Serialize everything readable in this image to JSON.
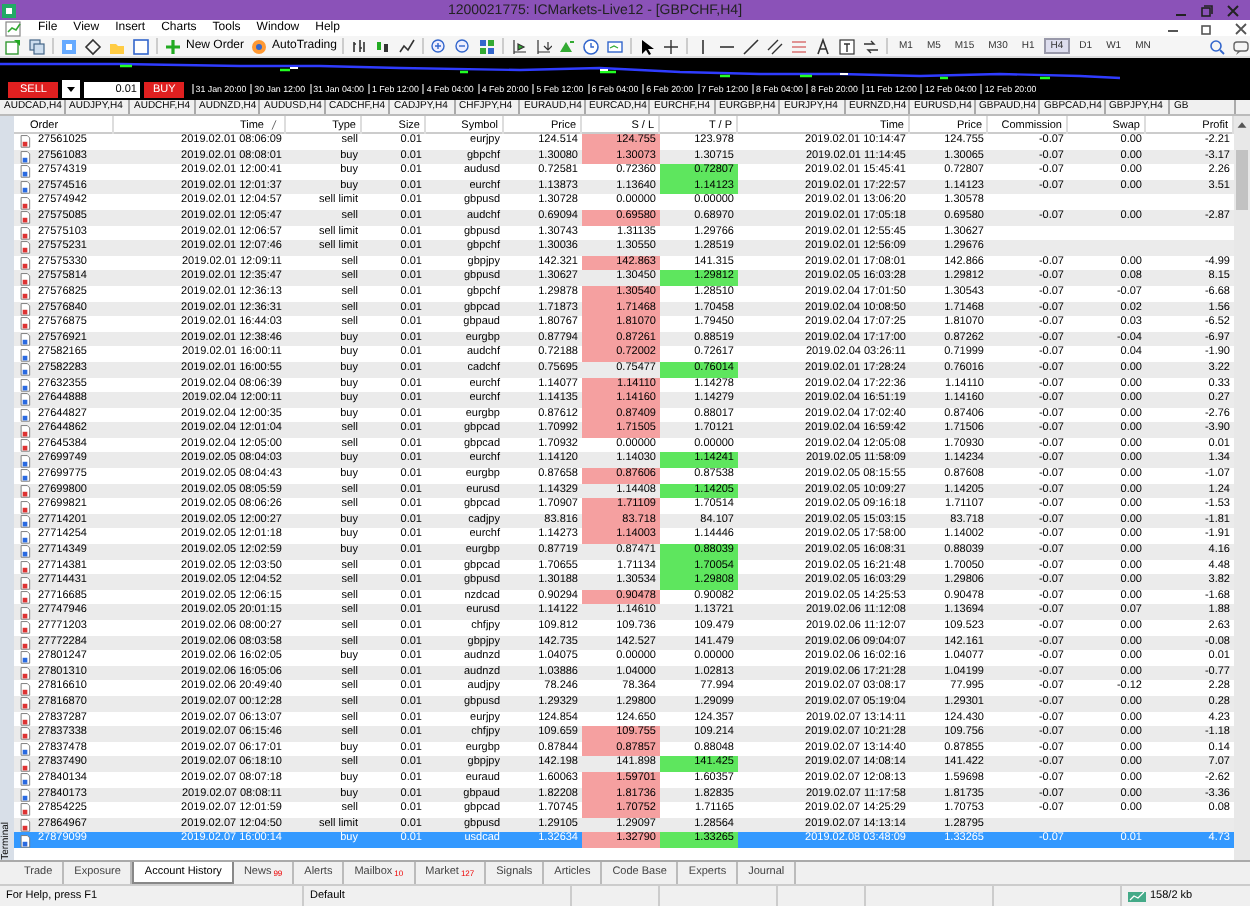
{
  "window": {
    "title": "1200021775: ICMarkets-Live12 - [GBPCHF,H4]"
  },
  "menu": [
    "File",
    "View",
    "Insert",
    "Charts",
    "Tools",
    "Window",
    "Help"
  ],
  "toolbar": {
    "buttons": [
      "New Order",
      "AutoTrading"
    ],
    "timeframes": [
      {
        "label": "M1",
        "selected": false
      },
      {
        "label": "M5",
        "selected": false
      },
      {
        "label": "M15",
        "selected": false
      },
      {
        "label": "M30",
        "selected": false
      },
      {
        "label": "H1",
        "selected": false
      },
      {
        "label": "H4",
        "selected": true
      },
      {
        "label": "D1",
        "selected": false
      },
      {
        "label": "W1",
        "selected": false
      },
      {
        "label": "MN",
        "selected": false
      }
    ]
  },
  "one_click": {
    "sell": "SELL",
    "lot": "0.01",
    "buy": "BUY"
  },
  "chart_axis": [
    "31 Jan 20:00",
    "30 Jan 12:00",
    "31 Jan 04:00",
    "1 Feb 12:00",
    "4 Feb 04:00",
    "4 Feb 20:00",
    "5 Feb 12:00",
    "6 Feb 04:00",
    "6 Feb 20:00",
    "7 Feb 12:00",
    "8 Feb 04:00",
    "8 Feb 20:00",
    "11 Feb 12:00",
    "12 Feb 04:00",
    "12 Feb 20:00"
  ],
  "chart_tabs": [
    "AUDCAD,H4",
    "AUDJPY,H4",
    "AUDCHF,H4",
    "AUDNZD,H4",
    "AUDUSD,H4",
    "CADCHF,H4",
    "CADJPY,H4",
    "CHFJPY,H4",
    "EURAUD,H4",
    "EURCAD,H4",
    "EURCHF,H4",
    "EURGBP,H4",
    "EURJPY,H4",
    "EURNZD,H4",
    "EURUSD,H4",
    "GBPAUD,H4",
    "GBPCAD,H4",
    "GBPJPY,H4",
    "GB"
  ],
  "table": {
    "columns": [
      "Order",
      "Time",
      "Type",
      "Size",
      "Symbol",
      "Price",
      "S / L",
      "T / P",
      "Time",
      "Price",
      "Commission",
      "Swap",
      "Profit"
    ],
    "rows": [
      {
        "order": "27561025",
        "open_time": "2019.02.01 08:06:09",
        "type": "sell",
        "size": "0.01",
        "symbol": "eurjpy",
        "price": "124.514",
        "sl": "124.755",
        "tp": "123.978",
        "close_time": "2019.02.01 10:14:47",
        "close_price": "124.755",
        "commission": "-0.07",
        "swap": "0.00",
        "profit": "-2.21",
        "sl_marked": true,
        "tp_marked": false,
        "selected": false
      },
      {
        "order": "27561083",
        "open_time": "2019.02.01 08:08:01",
        "type": "buy",
        "size": "0.01",
        "symbol": "gbpchf",
        "price": "1.30080",
        "sl": "1.30073",
        "tp": "1.30715",
        "close_time": "2019.02.01 11:14:45",
        "close_price": "1.30065",
        "commission": "-0.07",
        "swap": "0.00",
        "profit": "-3.17",
        "sl_marked": true,
        "tp_marked": false,
        "selected": false
      },
      {
        "order": "27574319",
        "open_time": "2019.02.01 12:00:41",
        "type": "buy",
        "size": "0.01",
        "symbol": "audusd",
        "price": "0.72581",
        "sl": "0.72360",
        "tp": "0.72807",
        "close_time": "2019.02.01 15:45:41",
        "close_price": "0.72807",
        "commission": "-0.07",
        "swap": "0.00",
        "profit": "2.26",
        "sl_marked": false,
        "tp_marked": true,
        "selected": false
      },
      {
        "order": "27574516",
        "open_time": "2019.02.01 12:01:37",
        "type": "buy",
        "size": "0.01",
        "symbol": "eurchf",
        "price": "1.13873",
        "sl": "1.13640",
        "tp": "1.14123",
        "close_time": "2019.02.01 17:22:57",
        "close_price": "1.14123",
        "commission": "-0.07",
        "swap": "0.00",
        "profit": "3.51",
        "sl_marked": false,
        "tp_marked": true,
        "selected": false
      },
      {
        "order": "27574942",
        "open_time": "2019.02.01 12:04:57",
        "type": "sell limit",
        "size": "0.01",
        "symbol": "gbpusd",
        "price": "1.30728",
        "sl": "0.00000",
        "tp": "0.00000",
        "close_time": "2019.02.01 13:06:20",
        "close_price": "1.30578",
        "sl_marked": false,
        "tp_marked": false,
        "selected": false
      },
      {
        "order": "27575085",
        "open_time": "2019.02.01 12:05:47",
        "type": "sell",
        "size": "0.01",
        "symbol": "audchf",
        "price": "0.69094",
        "sl": "0.69580",
        "tp": "0.68970",
        "close_time": "2019.02.01 17:05:18",
        "close_price": "0.69580",
        "commission": "-0.07",
        "swap": "0.00",
        "profit": "-2.87",
        "sl_marked": true,
        "tp_marked": false,
        "selected": false
      },
      {
        "order": "27575103",
        "open_time": "2019.02.01 12:06:57",
        "type": "sell limit",
        "size": "0.01",
        "symbol": "gbpusd",
        "price": "1.30743",
        "sl": "1.31135",
        "tp": "1.29766",
        "close_time": "2019.02.01 12:55:45",
        "close_price": "1.30627",
        "sl_marked": false,
        "tp_marked": false,
        "selected": false
      },
      {
        "order": "27575231",
        "open_time": "2019.02.01 12:07:46",
        "type": "sell limit",
        "size": "0.01",
        "symbol": "gbpchf",
        "price": "1.30036",
        "sl": "1.30550",
        "tp": "1.28519",
        "close_time": "2019.02.01 12:56:09",
        "close_price": "1.29676",
        "sl_marked": false,
        "tp_marked": false,
        "selected": false
      },
      {
        "order": "27575330",
        "open_time": "2019.02.01 12:09:11",
        "type": "sell",
        "size": "0.01",
        "symbol": "gbpjpy",
        "price": "142.321",
        "sl": "142.863",
        "tp": "141.315",
        "close_time": "2019.02.01 17:08:01",
        "close_price": "142.866",
        "commission": "-0.07",
        "swap": "0.00",
        "profit": "-4.99",
        "sl_marked": true,
        "tp_marked": false,
        "selected": false
      },
      {
        "order": "27575814",
        "open_time": "2019.02.01 12:35:47",
        "type": "sell",
        "size": "0.01",
        "symbol": "gbpusd",
        "price": "1.30627",
        "sl": "1.30450",
        "tp": "1.29812",
        "close_time": "2019.02.05 16:03:28",
        "close_price": "1.29812",
        "commission": "-0.07",
        "swap": "0.08",
        "profit": "8.15",
        "sl_marked": false,
        "tp_marked": true,
        "selected": false
      },
      {
        "order": "27576825",
        "open_time": "2019.02.01 12:36:13",
        "type": "sell",
        "size": "0.01",
        "symbol": "gbpchf",
        "price": "1.29878",
        "sl": "1.30540",
        "tp": "1.28510",
        "close_time": "2019.02.04 17:01:50",
        "close_price": "1.30543",
        "commission": "-0.07",
        "swap": "-0.07",
        "profit": "-6.68",
        "sl_marked": true,
        "tp_marked": false,
        "selected": false
      },
      {
        "order": "27576840",
        "open_time": "2019.02.01 12:36:31",
        "type": "sell",
        "size": "0.01",
        "symbol": "gbpcad",
        "price": "1.71873",
        "sl": "1.71468",
        "tp": "1.70458",
        "close_time": "2019.02.04 10:08:50",
        "close_price": "1.71468",
        "commission": "-0.07",
        "swap": "0.02",
        "profit": "1.56",
        "sl_marked": true,
        "tp_marked": false,
        "selected": false
      },
      {
        "order": "27576875",
        "open_time": "2019.02.01 16:44:03",
        "type": "sell",
        "size": "0.01",
        "symbol": "gbpaud",
        "price": "1.80767",
        "sl": "1.81070",
        "tp": "1.79450",
        "close_time": "2019.02.04 17:07:25",
        "close_price": "1.81070",
        "commission": "-0.07",
        "swap": "0.03",
        "profit": "-6.52",
        "sl_marked": true,
        "tp_marked": false,
        "selected": false
      },
      {
        "order": "27576921",
        "open_time": "2019.02.01 12:38:46",
        "type": "buy",
        "size": "0.01",
        "symbol": "eurgbp",
        "price": "0.87794",
        "sl": "0.87261",
        "tp": "0.88519",
        "close_time": "2019.02.04 17:17:00",
        "close_price": "0.87262",
        "commission": "-0.07",
        "swap": "-0.04",
        "profit": "-6.97",
        "sl_marked": true,
        "tp_marked": false,
        "selected": false
      },
      {
        "order": "27582165",
        "open_time": "2019.02.01 16:00:11",
        "type": "buy",
        "size": "0.01",
        "symbol": "audchf",
        "price": "0.72188",
        "sl": "0.72002",
        "tp": "0.72617",
        "close_time": "2019.02.04 03:26:11",
        "close_price": "0.71999",
        "commission": "-0.07",
        "swap": "0.04",
        "profit": "-1.90",
        "sl_marked": true,
        "tp_marked": false,
        "selected": false
      },
      {
        "order": "27582283",
        "open_time": "2019.02.01 16:00:55",
        "type": "buy",
        "size": "0.01",
        "symbol": "cadchf",
        "price": "0.75695",
        "sl": "0.75477",
        "tp": "0.76014",
        "close_time": "2019.02.01 17:28:24",
        "close_price": "0.76016",
        "commission": "-0.07",
        "swap": "0.00",
        "profit": "3.22",
        "sl_marked": false,
        "tp_marked": true,
        "selected": false
      },
      {
        "order": "27632355",
        "open_time": "2019.02.04 08:06:39",
        "type": "buy",
        "size": "0.01",
        "symbol": "eurchf",
        "price": "1.14077",
        "sl": "1.14110",
        "tp": "1.14278",
        "close_time": "2019.02.04 17:22:36",
        "close_price": "1.14110",
        "commission": "-0.07",
        "swap": "0.00",
        "profit": "0.33",
        "sl_marked": true,
        "tp_marked": false,
        "selected": false
      },
      {
        "order": "27644888",
        "open_time": "2019.02.04 12:00:11",
        "type": "buy",
        "size": "0.01",
        "symbol": "eurchf",
        "price": "1.14135",
        "sl": "1.14160",
        "tp": "1.14279",
        "close_time": "2019.02.04 16:51:19",
        "close_price": "1.14160",
        "commission": "-0.07",
        "swap": "0.00",
        "profit": "0.27",
        "sl_marked": true,
        "tp_marked": false,
        "selected": false
      },
      {
        "order": "27644827",
        "open_time": "2019.02.04 12:00:35",
        "type": "buy",
        "size": "0.01",
        "symbol": "eurgbp",
        "price": "0.87612",
        "sl": "0.87409",
        "tp": "0.88017",
        "close_time": "2019.02.04 17:02:40",
        "close_price": "0.87406",
        "commission": "-0.07",
        "swap": "0.00",
        "profit": "-2.76",
        "sl_marked": true,
        "tp_marked": false,
        "selected": false
      },
      {
        "order": "27644862",
        "open_time": "2019.02.04 12:01:04",
        "type": "sell",
        "size": "0.01",
        "symbol": "gbpcad",
        "price": "1.70992",
        "sl": "1.71505",
        "tp": "1.70121",
        "close_time": "2019.02.04 16:59:42",
        "close_price": "1.71506",
        "commission": "-0.07",
        "swap": "0.00",
        "profit": "-3.90",
        "sl_marked": true,
        "tp_marked": false,
        "selected": false
      },
      {
        "order": "27645384",
        "open_time": "2019.02.04 12:05:00",
        "type": "sell",
        "size": "0.01",
        "symbol": "gbpcad",
        "price": "1.70932",
        "sl": "0.00000",
        "tp": "0.00000",
        "close_time": "2019.02.04 12:05:08",
        "close_price": "1.70930",
        "commission": "-0.07",
        "swap": "0.00",
        "profit": "0.01",
        "sl_marked": false,
        "tp_marked": false,
        "selected": false
      },
      {
        "order": "27699749",
        "open_time": "2019.02.05 08:04:03",
        "type": "buy",
        "size": "0.01",
        "symbol": "eurchf",
        "price": "1.14120",
        "sl": "1.14030",
        "tp": "1.14241",
        "close_time": "2019.02.05 11:58:09",
        "close_price": "1.14234",
        "commission": "-0.07",
        "swap": "0.00",
        "profit": "1.34",
        "sl_marked": false,
        "tp_marked": true,
        "selected": false
      },
      {
        "order": "27699775",
        "open_time": "2019.02.05 08:04:43",
        "type": "buy",
        "size": "0.01",
        "symbol": "eurgbp",
        "price": "0.87658",
        "sl": "0.87606",
        "tp": "0.87538",
        "close_time": "2019.02.05 08:15:55",
        "close_price": "0.87608",
        "commission": "-0.07",
        "swap": "0.00",
        "profit": "-1.07",
        "sl_marked": true,
        "tp_marked": false,
        "selected": false
      },
      {
        "order": "27699800",
        "open_time": "2019.02.05 08:05:59",
        "type": "sell",
        "size": "0.01",
        "symbol": "eurusd",
        "price": "1.14329",
        "sl": "1.14408",
        "tp": "1.14205",
        "close_time": "2019.02.05 10:09:27",
        "close_price": "1.14205",
        "commission": "-0.07",
        "swap": "0.00",
        "profit": "1.24",
        "sl_marked": false,
        "tp_marked": true,
        "selected": false
      },
      {
        "order": "27699821",
        "open_time": "2019.02.05 08:06:26",
        "type": "sell",
        "size": "0.01",
        "symbol": "gbpcad",
        "price": "1.70907",
        "sl": "1.71109",
        "tp": "1.70514",
        "close_time": "2019.02.05 09:16:18",
        "close_price": "1.71107",
        "commission": "-0.07",
        "swap": "0.00",
        "profit": "-1.53",
        "sl_marked": true,
        "tp_marked": false,
        "selected": false
      },
      {
        "order": "27714201",
        "open_time": "2019.02.05 12:00:27",
        "type": "buy",
        "size": "0.01",
        "symbol": "cadjpy",
        "price": "83.816",
        "sl": "83.718",
        "tp": "84.107",
        "close_time": "2019.02.05 15:03:15",
        "close_price": "83.718",
        "commission": "-0.07",
        "swap": "0.00",
        "profit": "-1.81",
        "sl_marked": true,
        "tp_marked": false,
        "selected": false
      },
      {
        "order": "27714254",
        "open_time": "2019.02.05 12:01:18",
        "type": "buy",
        "size": "0.01",
        "symbol": "eurchf",
        "price": "1.14273",
        "sl": "1.14003",
        "tp": "1.14446",
        "close_time": "2019.02.05 17:58:00",
        "close_price": "1.14002",
        "commission": "-0.07",
        "swap": "0.00",
        "profit": "-1.91",
        "sl_marked": true,
        "tp_marked": false,
        "selected": false
      },
      {
        "order": "27714349",
        "open_time": "2019.02.05 12:02:59",
        "type": "buy",
        "size": "0.01",
        "symbol": "eurgbp",
        "price": "0.87719",
        "sl": "0.87471",
        "tp": "0.88039",
        "close_time": "2019.02.05 16:08:31",
        "close_price": "0.88039",
        "commission": "-0.07",
        "swap": "0.00",
        "profit": "4.16",
        "sl_marked": false,
        "tp_marked": true,
        "selected": false
      },
      {
        "order": "27714381",
        "open_time": "2019.02.05 12:03:50",
        "type": "sell",
        "size": "0.01",
        "symbol": "gbpcad",
        "price": "1.70655",
        "sl": "1.71134",
        "tp": "1.70054",
        "close_time": "2019.02.05 16:21:48",
        "close_price": "1.70050",
        "commission": "-0.07",
        "swap": "0.00",
        "profit": "4.48",
        "sl_marked": false,
        "tp_marked": true,
        "selected": false
      },
      {
        "order": "27714431",
        "open_time": "2019.02.05 12:04:52",
        "type": "sell",
        "size": "0.01",
        "symbol": "gbpusd",
        "price": "1.30188",
        "sl": "1.30534",
        "tp": "1.29808",
        "close_time": "2019.02.05 16:03:29",
        "close_price": "1.29806",
        "commission": "-0.07",
        "swap": "0.00",
        "profit": "3.82",
        "sl_marked": false,
        "tp_marked": true,
        "selected": false
      },
      {
        "order": "27716685",
        "open_time": "2019.02.05 12:06:15",
        "type": "sell",
        "size": "0.01",
        "symbol": "nzdcad",
        "price": "0.90294",
        "sl": "0.90478",
        "tp": "0.90082",
        "close_time": "2019.02.05 14:25:53",
        "close_price": "0.90478",
        "commission": "-0.07",
        "swap": "0.00",
        "profit": "-1.68",
        "sl_marked": true,
        "tp_marked": false,
        "selected": false
      },
      {
        "order": "27747946",
        "open_time": "2019.02.05 20:01:15",
        "type": "sell",
        "size": "0.01",
        "symbol": "eurusd",
        "price": "1.14122",
        "sl": "1.14610",
        "tp": "1.13721",
        "close_time": "2019.02.06 11:12:08",
        "close_price": "1.13694",
        "commission": "-0.07",
        "swap": "0.07",
        "profit": "1.88",
        "sl_marked": false,
        "tp_marked": false,
        "selected": false
      },
      {
        "order": "27771203",
        "open_time": "2019.02.06 08:00:27",
        "type": "sell",
        "size": "0.01",
        "symbol": "chfjpy",
        "price": "109.812",
        "sl": "109.736",
        "tp": "109.479",
        "close_time": "2019.02.06 11:12:07",
        "close_price": "109.523",
        "commission": "-0.07",
        "swap": "0.00",
        "profit": "2.63",
        "sl_marked": false,
        "tp_marked": false,
        "selected": false
      },
      {
        "order": "27772284",
        "open_time": "2019.02.06 08:03:58",
        "type": "sell",
        "size": "0.01",
        "symbol": "gbpjpy",
        "price": "142.735",
        "sl": "142.527",
        "tp": "141.479",
        "close_time": "2019.02.06 09:04:07",
        "close_price": "142.161",
        "commission": "-0.07",
        "swap": "0.00",
        "profit": "-0.08",
        "sl_marked": false,
        "tp_marked": false,
        "selected": false
      },
      {
        "order": "27801247",
        "open_time": "2019.02.06 16:02:05",
        "type": "buy",
        "size": "0.01",
        "symbol": "audnzd",
        "price": "1.04075",
        "sl": "0.00000",
        "tp": "0.00000",
        "close_time": "2019.02.06 16:02:16",
        "close_price": "1.04077",
        "commission": "-0.07",
        "swap": "0.00",
        "profit": "0.01",
        "sl_marked": false,
        "tp_marked": false,
        "selected": false
      },
      {
        "order": "27801310",
        "open_time": "2019.02.06 16:05:06",
        "type": "sell",
        "size": "0.01",
        "symbol": "audnzd",
        "price": "1.03886",
        "sl": "1.04000",
        "tp": "1.02813",
        "close_time": "2019.02.06 17:21:28",
        "close_price": "1.04199",
        "commission": "-0.07",
        "swap": "0.00",
        "profit": "-0.77",
        "sl_marked": false,
        "tp_marked": false,
        "selected": false
      },
      {
        "order": "27816610",
        "open_time": "2019.02.06 20:49:40",
        "type": "sell",
        "size": "0.01",
        "symbol": "audjpy",
        "price": "78.246",
        "sl": "78.364",
        "tp": "77.994",
        "close_time": "2019.02.07 03:08:17",
        "close_price": "77.995",
        "commission": "-0.07",
        "swap": "-0.12",
        "profit": "2.28",
        "sl_marked": false,
        "tp_marked": false,
        "selected": false
      },
      {
        "order": "27816870",
        "open_time": "2019.02.07 00:12:28",
        "type": "sell",
        "size": "0.01",
        "symbol": "gbpusd",
        "price": "1.29329",
        "sl": "1.29800",
        "tp": "1.29099",
        "close_time": "2019.02.07 05:19:04",
        "close_price": "1.29301",
        "commission": "-0.07",
        "swap": "0.00",
        "profit": "0.28",
        "sl_marked": false,
        "tp_marked": false,
        "selected": false
      },
      {
        "order": "27837287",
        "open_time": "2019.02.07 06:13:07",
        "type": "sell",
        "size": "0.01",
        "symbol": "eurjpy",
        "price": "124.854",
        "sl": "124.650",
        "tp": "124.357",
        "close_time": "2019.02.07 13:14:11",
        "close_price": "124.430",
        "commission": "-0.07",
        "swap": "0.00",
        "profit": "4.23",
        "sl_marked": false,
        "tp_marked": false,
        "selected": false
      },
      {
        "order": "27837338",
        "open_time": "2019.02.07 06:15:46",
        "type": "sell",
        "size": "0.01",
        "symbol": "chfjpy",
        "price": "109.659",
        "sl": "109.755",
        "tp": "109.214",
        "close_time": "2019.02.07 10:21:28",
        "close_price": "109.756",
        "commission": "-0.07",
        "swap": "0.00",
        "profit": "-1.18",
        "sl_marked": true,
        "tp_marked": false,
        "selected": false
      },
      {
        "order": "27837478",
        "open_time": "2019.02.07 06:17:01",
        "type": "buy",
        "size": "0.01",
        "symbol": "eurgbp",
        "price": "0.87844",
        "sl": "0.87857",
        "tp": "0.88048",
        "close_time": "2019.02.07 13:14:40",
        "close_price": "0.87855",
        "commission": "-0.07",
        "swap": "0.00",
        "profit": "0.14",
        "sl_marked": true,
        "tp_marked": false,
        "selected": false
      },
      {
        "order": "27837490",
        "open_time": "2019.02.07 06:18:10",
        "type": "sell",
        "size": "0.01",
        "symbol": "gbpjpy",
        "price": "142.198",
        "sl": "141.898",
        "tp": "141.425",
        "close_time": "2019.02.07 14:08:14",
        "close_price": "141.422",
        "commission": "-0.07",
        "swap": "0.00",
        "profit": "7.07",
        "sl_marked": false,
        "tp_marked": true,
        "selected": false
      },
      {
        "order": "27840134",
        "open_time": "2019.02.07 08:07:18",
        "type": "buy",
        "size": "0.01",
        "symbol": "euraud",
        "price": "1.60063",
        "sl": "1.59701",
        "tp": "1.60357",
        "close_time": "2019.02.07 12:08:13",
        "close_price": "1.59698",
        "commission": "-0.07",
        "swap": "0.00",
        "profit": "-2.62",
        "sl_marked": true,
        "tp_marked": false,
        "selected": false
      },
      {
        "order": "27840173",
        "open_time": "2019.02.07 08:08:11",
        "type": "buy",
        "size": "0.01",
        "symbol": "gbpaud",
        "price": "1.82208",
        "sl": "1.81736",
        "tp": "1.82835",
        "close_time": "2019.02.07 11:17:58",
        "close_price": "1.81735",
        "commission": "-0.07",
        "swap": "0.00",
        "profit": "-3.36",
        "sl_marked": true,
        "tp_marked": false,
        "selected": false
      },
      {
        "order": "27854225",
        "open_time": "2019.02.07 12:01:59",
        "type": "sell",
        "size": "0.01",
        "symbol": "gbpcad",
        "price": "1.70745",
        "sl": "1.70752",
        "tp": "1.71165",
        "close_time": "2019.02.07 14:25:29",
        "close_price": "1.70753",
        "commission": "-0.07",
        "swap": "0.00",
        "profit": "0.08",
        "sl_marked": true,
        "tp_marked": false,
        "selected": false
      },
      {
        "order": "27864967",
        "open_time": "2019.02.07 12:04:50",
        "type": "sell limit",
        "size": "0.01",
        "symbol": "gbpusd",
        "price": "1.29105",
        "sl": "1.29097",
        "tp": "1.28564",
        "close_time": "2019.02.07 14:13:14",
        "close_price": "1.28795",
        "sl_marked": false,
        "tp_marked": false,
        "selected": false
      },
      {
        "order": "27879099",
        "open_time": "2019.02.07 16:00:14",
        "type": "buy",
        "size": "0.01",
        "symbol": "usdcad",
        "price": "1.32634",
        "sl": "1.32790",
        "tp": "1.33265",
        "close_time": "2019.02.08 03:48:09",
        "close_price": "1.33265",
        "commission": "-0.07",
        "swap": "0.01",
        "profit": "4.73",
        "sl_marked": true,
        "tp_marked": true,
        "selected": true
      }
    ]
  },
  "terminal_label": "Terminal",
  "bottom_tabs": [
    {
      "label": "Trade",
      "selected": false
    },
    {
      "label": "Exposure",
      "selected": false
    },
    {
      "label": "Account History",
      "selected": true
    },
    {
      "label": "News",
      "badge": "99",
      "selected": false
    },
    {
      "label": "Alerts",
      "selected": false
    },
    {
      "label": "Mailbox",
      "badge": "10",
      "selected": false
    },
    {
      "label": "Market",
      "badge": "127",
      "selected": false
    },
    {
      "label": "Signals",
      "selected": false
    },
    {
      "label": "Articles",
      "selected": false
    },
    {
      "label": "Code Base",
      "selected": false
    },
    {
      "label": "Experts",
      "selected": false
    },
    {
      "label": "Journal",
      "selected": false
    }
  ],
  "status_bar": [
    "For Help, press F1",
    "Default",
    "158/2 kb"
  ]
}
